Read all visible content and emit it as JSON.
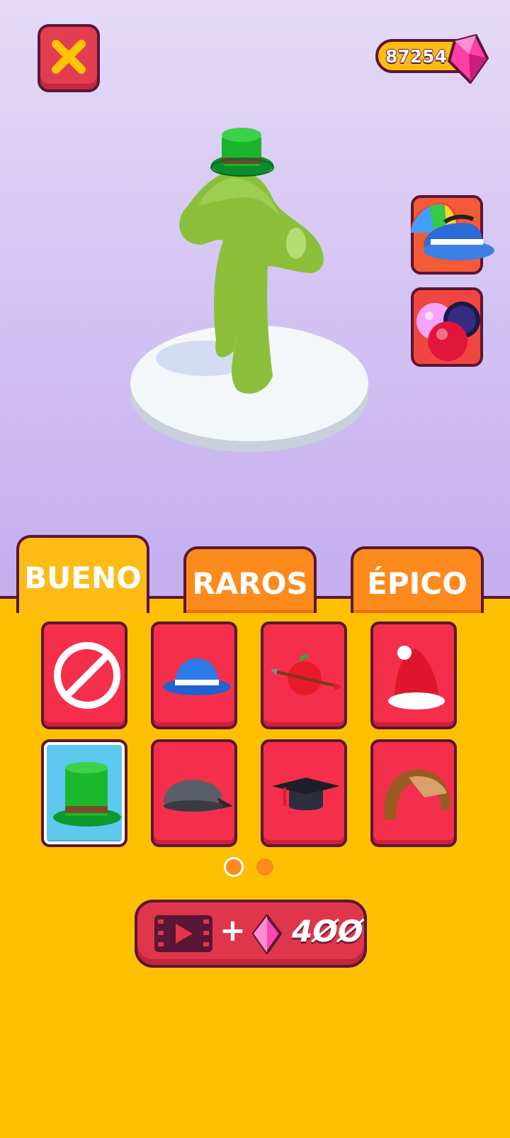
{
  "header": {
    "close_icon": "close-x-icon",
    "gem_count": "87254",
    "gem_icon": "pink-gem-icon"
  },
  "side_buttons": [
    {
      "icon": "hats-category-icon"
    },
    {
      "icon": "balls-category-icon"
    }
  ],
  "tabs": [
    {
      "label": "BUENO",
      "active": true
    },
    {
      "label": "RAROS",
      "active": false
    },
    {
      "label": "ÉPICO",
      "active": false
    }
  ],
  "items": [
    {
      "icon": "none-icon",
      "selected": false
    },
    {
      "icon": "blue-bowler-hat-icon",
      "selected": false
    },
    {
      "icon": "apple-arrow-hat-icon",
      "selected": false
    },
    {
      "icon": "santa-hat-icon",
      "selected": false
    },
    {
      "icon": "green-top-hat-icon",
      "selected": true
    },
    {
      "icon": "grey-cap-icon",
      "selected": false
    },
    {
      "icon": "graduation-cap-icon",
      "selected": false
    },
    {
      "icon": "aviator-hat-icon",
      "selected": false
    }
  ],
  "pagination": {
    "pages": 2,
    "current": 1
  },
  "buy_button": {
    "video_icon": "video-ad-icon",
    "plus": "+",
    "gem_icon": "pink-gem-icon",
    "price": "4ØØ"
  },
  "colors": {
    "panel": "#fdc000",
    "tab": "#fc8a1c",
    "item": "#f52f4b",
    "selected_item": "#5fc8ef",
    "outline": "#5a1636"
  }
}
